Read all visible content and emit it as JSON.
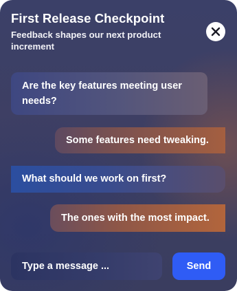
{
  "header": {
    "title": "First Release Checkpoint",
    "subtitle": "Feedback shapes our next product increment"
  },
  "close_icon": "close-icon",
  "messages": [
    {
      "role": "bot",
      "text": "Are the key features meeting user needs?"
    },
    {
      "role": "user",
      "text": "Some features need tweaking."
    },
    {
      "role": "bot",
      "text": "What should we work on first?"
    },
    {
      "role": "user",
      "text": "The ones with the most impact."
    }
  ],
  "composer": {
    "placeholder": "Type a message ...",
    "value": "",
    "send_label": "Send"
  },
  "colors": {
    "send_button": "#2f5cf5",
    "close_button": "#ffffff",
    "user_bubble_accent": "#b2653c",
    "bot_bubble_accent": "#2b4ea0"
  }
}
